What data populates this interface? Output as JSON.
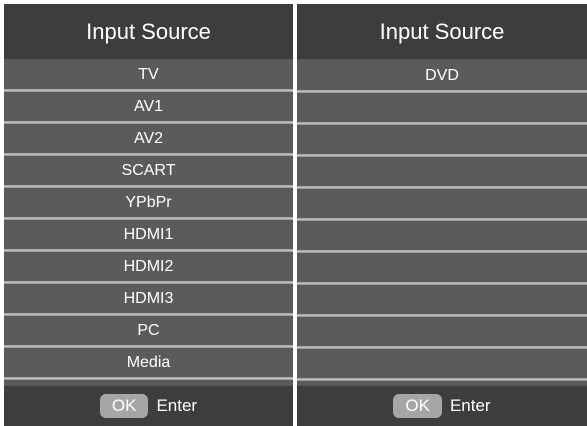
{
  "panels": {
    "left": {
      "title": "Input Source",
      "items": [
        "TV",
        "AV1",
        "AV2",
        "SCART",
        "YPbPr",
        "HDMI1",
        "HDMI2",
        "HDMI3",
        "PC",
        "Media"
      ],
      "footer": {
        "button": "OK",
        "label": "Enter"
      }
    },
    "right": {
      "title": "Input Source",
      "items": [
        "DVD",
        "",
        "",
        "",
        "",
        "",
        "",
        "",
        "",
        ""
      ],
      "footer": {
        "button": "OK",
        "label": "Enter"
      }
    }
  },
  "colors": {
    "panel_bg": "#5a5a5a",
    "header_bg": "#3d3d3d",
    "separator": "#c9c9c9",
    "ok_button_bg": "#a6a6a6",
    "text": "#ffffff"
  }
}
